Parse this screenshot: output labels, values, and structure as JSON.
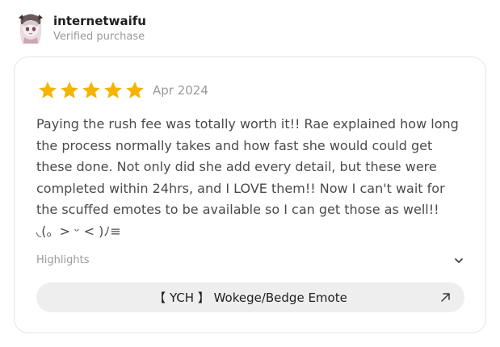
{
  "reviewer": {
    "name": "internetwaifu",
    "subtitle": "Verified purchase",
    "avatar_icon": "anime-character-avatar"
  },
  "review": {
    "rating": 5,
    "rating_max": 5,
    "star_color": "#f4b400",
    "date": "Apr 2024",
    "text": "Paying the rush fee was totally worth it!! Rae explained how long the process normally takes and how fast she would could get these done. Not only did she add every detail, but these were completed within 24hrs, and I LOVE them!! Now I can't wait for the scuffed emotes to be available so I can get those as well!! ◟(。> ᵕ < )ﾉ≡"
  },
  "highlights": {
    "label": "Highlights",
    "icon": "chevron-down-icon"
  },
  "listing": {
    "label": "【 YCH 】 Wokege/Bedge Emote",
    "icon": "arrow-up-right-icon",
    "background": "#efeeef"
  }
}
